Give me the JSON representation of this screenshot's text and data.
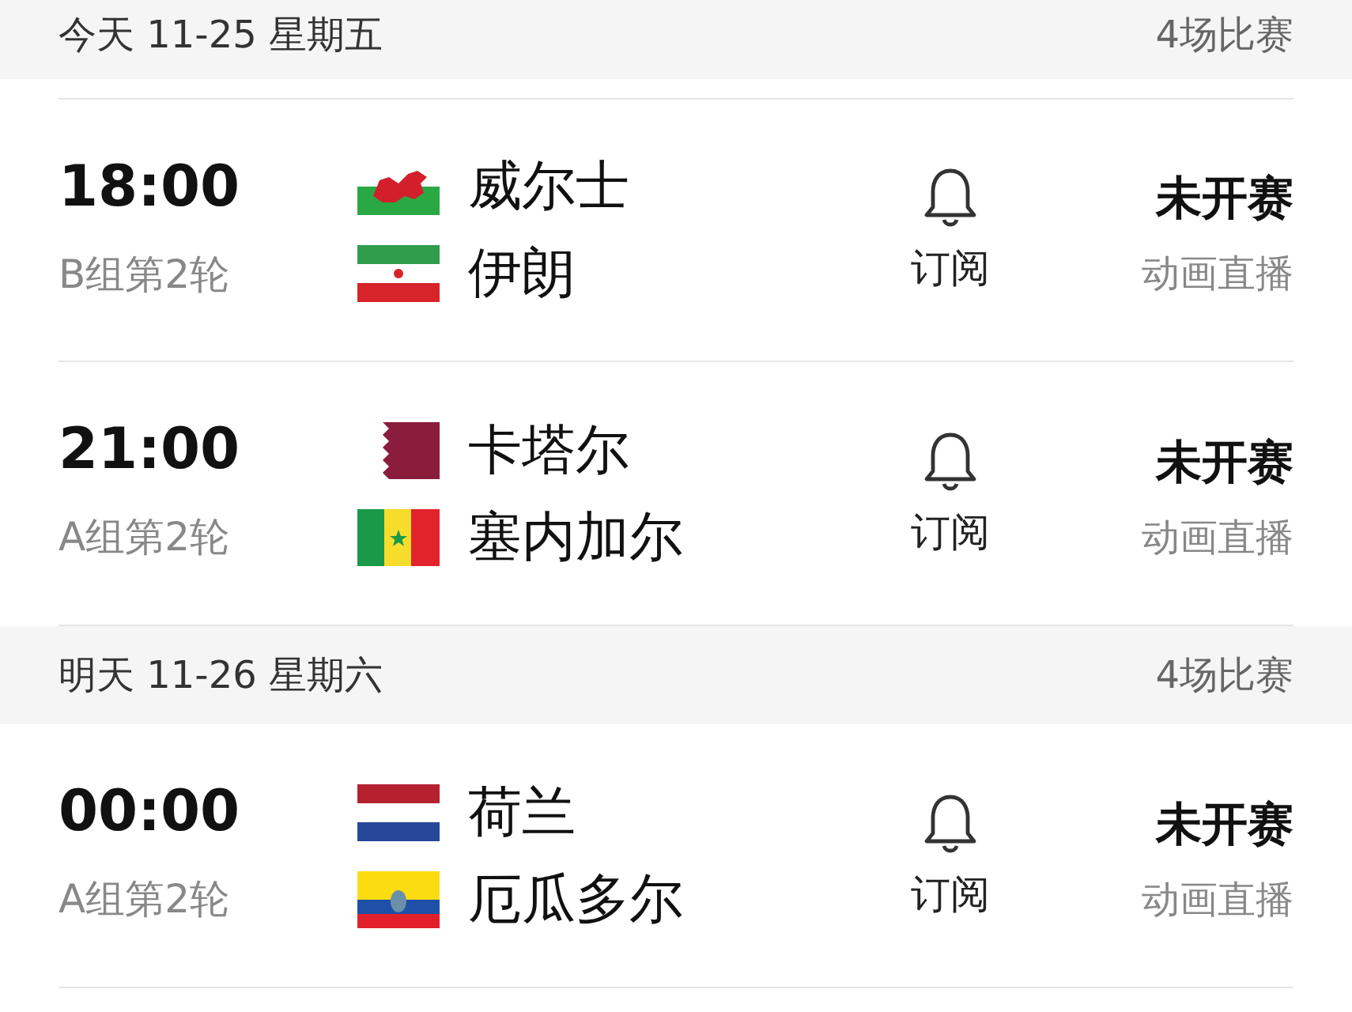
{
  "days": [
    {
      "title": "今天 11-25 星期五",
      "count": "4场比赛",
      "matches": [
        {
          "time": "18:00",
          "round": "B组第2轮",
          "teams": [
            {
              "kind": "wales",
              "name": "威尔士"
            },
            {
              "kind": "iran",
              "name": "伊朗"
            }
          ],
          "subscribe": "订阅",
          "status": "未开赛",
          "broadcast": "动画直播"
        },
        {
          "time": "21:00",
          "round": "A组第2轮",
          "teams": [
            {
              "kind": "qatar",
              "name": "卡塔尔"
            },
            {
              "kind": "senegal",
              "name": "塞内加尔"
            }
          ],
          "subscribe": "订阅",
          "status": "未开赛",
          "broadcast": "动画直播"
        }
      ]
    },
    {
      "title": "明天 11-26 星期六",
      "count": "4场比赛",
      "matches": [
        {
          "time": "00:00",
          "round": "A组第2轮",
          "teams": [
            {
              "kind": "netherlands",
              "name": "荷兰"
            },
            {
              "kind": "ecuador",
              "name": "厄瓜多尔"
            }
          ],
          "subscribe": "订阅",
          "status": "未开赛",
          "broadcast": "动画直播"
        }
      ]
    }
  ]
}
